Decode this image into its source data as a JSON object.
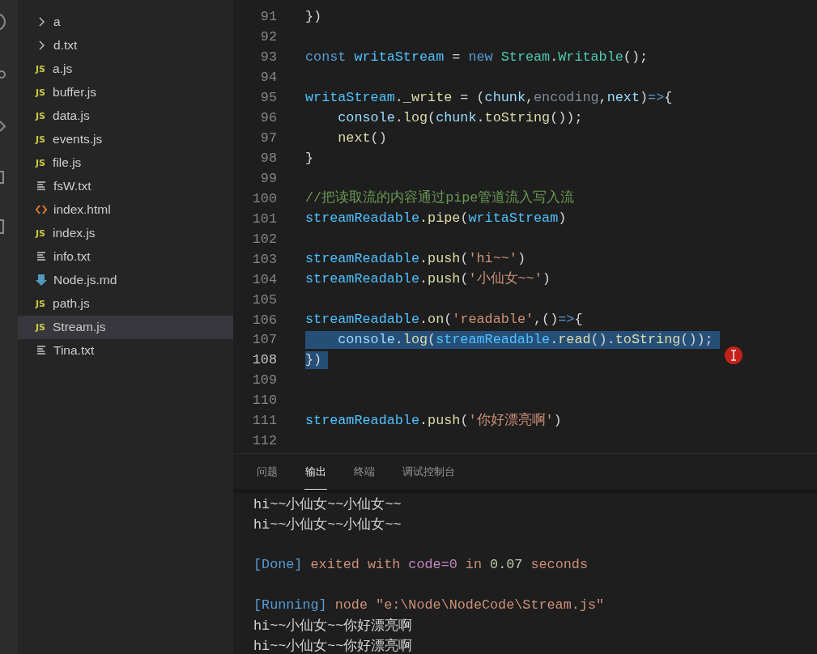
{
  "sidebar": {
    "items": [
      {
        "label": "a",
        "kind": "folder",
        "expanded": false,
        "selected": false
      },
      {
        "label": "d.txt",
        "kind": "folder",
        "expanded": false,
        "selected": false
      },
      {
        "label": "a.js",
        "kind": "js",
        "badge": "JS",
        "selected": false
      },
      {
        "label": "buffer.js",
        "kind": "js",
        "badge": "JS",
        "selected": false
      },
      {
        "label": "data.js",
        "kind": "js",
        "badge": "JS",
        "selected": false
      },
      {
        "label": "events.js",
        "kind": "js",
        "badge": "JS",
        "selected": false
      },
      {
        "label": "file.js",
        "kind": "js",
        "badge": "JS",
        "selected": false
      },
      {
        "label": "fsW.txt",
        "kind": "txt",
        "selected": false
      },
      {
        "label": "index.html",
        "kind": "html",
        "selected": false
      },
      {
        "label": "index.js",
        "kind": "js",
        "badge": "JS",
        "selected": false
      },
      {
        "label": "info.txt",
        "kind": "txt",
        "selected": false
      },
      {
        "label": "Node.js.md",
        "kind": "md",
        "selected": false
      },
      {
        "label": "path.js",
        "kind": "js",
        "badge": "JS",
        "selected": false
      },
      {
        "label": "Stream.js",
        "kind": "js",
        "badge": "JS",
        "selected": true
      },
      {
        "label": "Tina.txt",
        "kind": "txt",
        "selected": false
      }
    ]
  },
  "editor": {
    "lines": [
      {
        "number": "91",
        "current": false,
        "selected": false,
        "tokens": [
          {
            "kind": "punc",
            "text": "})"
          }
        ]
      },
      {
        "number": "92",
        "current": false,
        "selected": false
      },
      {
        "number": "93",
        "current": false,
        "selected": false,
        "tokens": [
          {
            "kind": "kw",
            "text": "const "
          },
          {
            "kind": "var",
            "text": "writaStream"
          },
          {
            "kind": "punc",
            "text": " = "
          },
          {
            "kind": "kw",
            "text": "new "
          },
          {
            "kind": "cls",
            "text": "Stream"
          },
          {
            "kind": "punc",
            "text": "."
          },
          {
            "kind": "cls",
            "text": "Writable"
          },
          {
            "kind": "punc",
            "text": "();"
          }
        ]
      },
      {
        "number": "94",
        "current": false,
        "selected": false
      },
      {
        "number": "95",
        "current": false,
        "selected": false,
        "tokens": [
          {
            "kind": "var",
            "text": "writaStream"
          },
          {
            "kind": "punc",
            "text": "."
          },
          {
            "kind": "fn",
            "text": "_write"
          },
          {
            "kind": "punc",
            "text": " = ("
          },
          {
            "kind": "param",
            "text": "chunk"
          },
          {
            "kind": "punc",
            "text": ","
          },
          {
            "kind": "dim",
            "text": "encoding"
          },
          {
            "kind": "punc",
            "text": ","
          },
          {
            "kind": "param",
            "text": "next"
          },
          {
            "kind": "punc",
            "text": ")"
          },
          {
            "kind": "kw",
            "text": "=>"
          },
          {
            "kind": "punc",
            "text": "{"
          }
        ]
      },
      {
        "number": "96",
        "current": false,
        "selected": false,
        "tokens": [
          {
            "kind": "param",
            "text": "    console"
          },
          {
            "kind": "punc",
            "text": "."
          },
          {
            "kind": "fn",
            "text": "log"
          },
          {
            "kind": "punc",
            "text": "("
          },
          {
            "kind": "param",
            "text": "chunk"
          },
          {
            "kind": "punc",
            "text": "."
          },
          {
            "kind": "fn",
            "text": "toString"
          },
          {
            "kind": "punc",
            "text": "());"
          }
        ]
      },
      {
        "number": "97",
        "current": false,
        "selected": false,
        "tokens": [
          {
            "kind": "fn",
            "text": "    next"
          },
          {
            "kind": "punc",
            "text": "()"
          }
        ]
      },
      {
        "number": "98",
        "current": false,
        "selected": false,
        "tokens": [
          {
            "kind": "punc",
            "text": "}"
          }
        ]
      },
      {
        "number": "99",
        "current": false,
        "selected": false
      },
      {
        "number": "100",
        "current": false,
        "selected": false,
        "tokens": [
          {
            "kind": "cmt",
            "text": "//把读取流的内容通过pipe管道流入写入流"
          }
        ]
      },
      {
        "number": "101",
        "current": false,
        "selected": false,
        "tokens": [
          {
            "kind": "var",
            "text": "streamReadable"
          },
          {
            "kind": "punc",
            "text": "."
          },
          {
            "kind": "fn",
            "text": "pipe"
          },
          {
            "kind": "punc",
            "text": "("
          },
          {
            "kind": "var",
            "text": "writaStream"
          },
          {
            "kind": "punc",
            "text": ")"
          }
        ]
      },
      {
        "number": "102",
        "current": false,
        "selected": false
      },
      {
        "number": "103",
        "current": false,
        "selected": false,
        "tokens": [
          {
            "kind": "var",
            "text": "streamReadable"
          },
          {
            "kind": "punc",
            "text": "."
          },
          {
            "kind": "fn",
            "text": "push"
          },
          {
            "kind": "punc",
            "text": "("
          },
          {
            "kind": "str",
            "text": "'hi~~'"
          },
          {
            "kind": "punc",
            "text": ")"
          }
        ]
      },
      {
        "number": "104",
        "current": false,
        "selected": false,
        "tokens": [
          {
            "kind": "var",
            "text": "streamReadable"
          },
          {
            "kind": "punc",
            "text": "."
          },
          {
            "kind": "fn",
            "text": "push"
          },
          {
            "kind": "punc",
            "text": "("
          },
          {
            "kind": "str",
            "text": "'小仙女~~'"
          },
          {
            "kind": "punc",
            "text": ")"
          }
        ]
      },
      {
        "number": "105",
        "current": false,
        "selected": false
      },
      {
        "number": "106",
        "current": false,
        "selected": false,
        "tokens": [
          {
            "kind": "var",
            "text": "streamReadable"
          },
          {
            "kind": "punc",
            "text": "."
          },
          {
            "kind": "fn",
            "text": "on"
          },
          {
            "kind": "punc",
            "text": "("
          },
          {
            "kind": "str",
            "text": "'readable'"
          },
          {
            "kind": "punc",
            "text": ",()"
          },
          {
            "kind": "kw",
            "text": "=>"
          },
          {
            "kind": "punc",
            "text": "{"
          }
        ]
      },
      {
        "number": "107",
        "current": false,
        "selected": true,
        "tokens": [
          {
            "kind": "param",
            "text": "    console"
          },
          {
            "kind": "punc",
            "text": "."
          },
          {
            "kind": "fn",
            "text": "log"
          },
          {
            "kind": "punc",
            "text": "("
          },
          {
            "kind": "var",
            "text": "streamReadable"
          },
          {
            "kind": "punc",
            "text": "."
          },
          {
            "kind": "fn",
            "text": "read"
          },
          {
            "kind": "punc",
            "text": "()."
          },
          {
            "kind": "fn",
            "text": "toString"
          },
          {
            "kind": "punc",
            "text": "());"
          }
        ]
      },
      {
        "number": "108",
        "current": true,
        "selected": true,
        "tokens": [
          {
            "kind": "punc",
            "text": "})"
          }
        ]
      },
      {
        "number": "109",
        "current": false,
        "selected": false
      },
      {
        "number": "110",
        "current": false,
        "selected": false
      },
      {
        "number": "111",
        "current": false,
        "selected": false,
        "tokens": [
          {
            "kind": "var",
            "text": "streamReadable"
          },
          {
            "kind": "punc",
            "text": "."
          },
          {
            "kind": "fn",
            "text": "push"
          },
          {
            "kind": "punc",
            "text": "("
          },
          {
            "kind": "str",
            "text": "'你好漂亮啊'"
          },
          {
            "kind": "punc",
            "text": ")"
          }
        ]
      },
      {
        "number": "112",
        "current": false,
        "selected": false
      }
    ]
  },
  "panel": {
    "tabs": [
      {
        "label": "问题",
        "selected": false
      },
      {
        "label": "输出",
        "selected": true
      },
      {
        "label": "终端",
        "selected": false
      },
      {
        "label": "调试控制台",
        "selected": false
      }
    ],
    "output": [
      {
        "kind": "text",
        "tokens": [
          {
            "kind": "plain",
            "text": "hi~~小仙女~~小仙女~~"
          }
        ]
      },
      {
        "kind": "text",
        "tokens": [
          {
            "kind": "plain",
            "text": "hi~~小仙女~~小仙女~~"
          }
        ]
      },
      {
        "kind": "blank"
      },
      {
        "kind": "text",
        "tokens": [
          {
            "kind": "tag",
            "text": "[Done]"
          },
          {
            "kind": "str",
            "text": " exited with "
          },
          {
            "kind": "key",
            "text": "code=0"
          },
          {
            "kind": "str",
            "text": " in "
          },
          {
            "kind": "num",
            "text": "0.07"
          },
          {
            "kind": "str",
            "text": " seconds"
          }
        ]
      },
      {
        "kind": "blank"
      },
      {
        "kind": "text",
        "tokens": [
          {
            "kind": "tag",
            "text": "[Running]"
          },
          {
            "kind": "str",
            "text": " node \"e:\\Node\\NodeCode\\Stream.js\""
          }
        ]
      },
      {
        "kind": "text",
        "tokens": [
          {
            "kind": "plain",
            "text": "hi~~小仙女~~你好漂亮啊"
          }
        ]
      },
      {
        "kind": "text",
        "tokens": [
          {
            "kind": "plain",
            "text": "hi~~小仙女~~你好漂亮啊"
          }
        ]
      }
    ]
  }
}
